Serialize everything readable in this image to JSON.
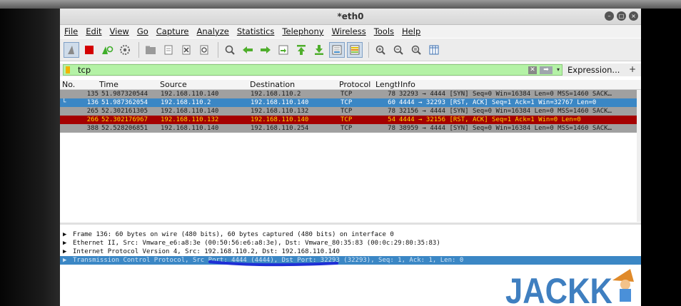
{
  "window": {
    "title": "*eth0"
  },
  "menu": [
    "File",
    "Edit",
    "View",
    "Go",
    "Capture",
    "Analyze",
    "Statistics",
    "Telephony",
    "Wireless",
    "Tools",
    "Help"
  ],
  "toolbar": {
    "icons": [
      "shark-fin-icon",
      "stop-icon",
      "restart-icon",
      "gear-icon",
      "open-folder-icon",
      "file-icon",
      "close-file-icon",
      "reload-icon",
      "find-icon",
      "back-arrow-icon",
      "forward-arrow-icon",
      "goto-icon",
      "first-packet-icon",
      "last-packet-icon",
      "autoscroll-icon",
      "colorize-icon",
      "zoom-in-icon",
      "zoom-out-icon",
      "zoom-normal-icon",
      "resize-columns-icon"
    ]
  },
  "filter": {
    "value": "tcp",
    "expression_label": "Expression...",
    "plus_label": "+"
  },
  "packet_list": {
    "columns": [
      "No.",
      "Time",
      "Source",
      "Destination",
      "Protocol",
      "Length",
      "Info"
    ],
    "rows": [
      {
        "no": "135",
        "time": "51.987320544",
        "src": "192.168.110.140",
        "dst": "192.168.110.2",
        "proto": "TCP",
        "len": "78",
        "info": "32293 → 4444 [SYN] Seq=0 Win=16384 Len=0 MSS=1460 SACK…",
        "style": "gray",
        "marker": ""
      },
      {
        "no": "136",
        "time": "51.987362054",
        "src": "192.168.110.2",
        "dst": "192.168.110.140",
        "proto": "TCP",
        "len": "60",
        "info": "4444 → 32293 [RST, ACK] Seq=1 Ack=1 Win=32767 Len=0",
        "style": "sel",
        "marker": "└"
      },
      {
        "no": "265",
        "time": "52.302161305",
        "src": "192.168.110.140",
        "dst": "192.168.110.132",
        "proto": "TCP",
        "len": "78",
        "info": "32156 → 4444 [SYN] Seq=0 Win=16384 Len=0 MSS=1460 SACK…",
        "style": "gray",
        "marker": ""
      },
      {
        "no": "266",
        "time": "52.302176967",
        "src": "192.168.110.132",
        "dst": "192.168.110.140",
        "proto": "TCP",
        "len": "54",
        "info": "4444 → 32156 [RST, ACK] Seq=1 Ack=1 Win=0 Len=0",
        "style": "red",
        "marker": ""
      },
      {
        "no": "388",
        "time": "52.528206851",
        "src": "192.168.110.140",
        "dst": "192.168.110.254",
        "proto": "TCP",
        "len": "78",
        "info": "38959 → 4444 [SYN] Seq=0 Win=16384 Len=0 MSS=1460 SACK…",
        "style": "gray",
        "marker": ""
      }
    ]
  },
  "details": [
    "Frame 136: 60 bytes on wire (480 bits), 60 bytes captured (480 bits) on interface 0",
    "Ethernet II, Src: Vmware_e6:a8:3e (00:50:56:e6:a8:3e), Dst: Vmware_80:35:83 (00:0c:29:80:35:83)",
    "Internet Protocol Version 4, Src: 192.168.110.2, Dst: 192.168.110.140",
    "Transmission Control Protocol, Src Port: 4444 (4444), Dst Port: 32293 (32293), Seq: 1, Ack: 1, Len: 0"
  ],
  "selected_detail": 3,
  "logo": {
    "text": "JACKK"
  },
  "colors": {
    "selected_row": "#3b87c5",
    "bad_row": "#a50000",
    "bad_row_text": "#ffd900",
    "filter_ok": "#b4f2a6",
    "annotation": "#1f2fd6"
  }
}
